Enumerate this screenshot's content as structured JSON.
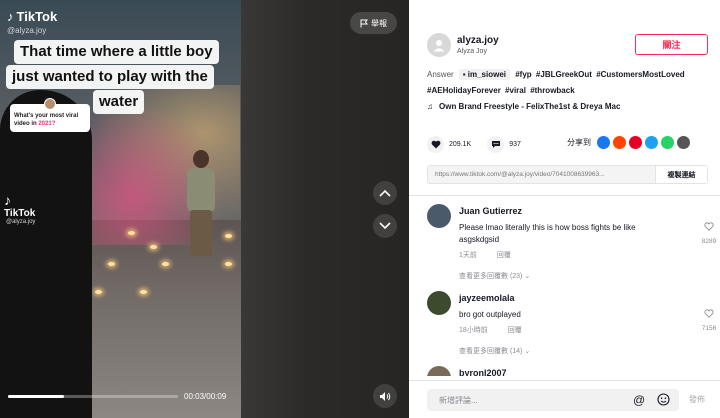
{
  "video": {
    "logo_text": "TikTok",
    "handle": "@alyza.joy",
    "watermark_logo": "TikTok",
    "watermark_handle": "@alyza.joy",
    "caption_lines": [
      "That time where a little boy",
      "just wanted to play with the",
      "water"
    ],
    "viral_card_text": "What's your most viral video in",
    "viral_card_year": "2021?",
    "report_label": "舉報",
    "time_readout": "00:03/00:09",
    "progress_fraction": 0.33,
    "icons": {
      "report": "flag-icon",
      "up": "chevron-up-icon",
      "down": "chevron-down-icon",
      "volume": "volume-icon"
    }
  },
  "author": {
    "name": "alyza.joy",
    "display_name": "Alyza Joy",
    "follow_label": "關注"
  },
  "description": {
    "answer_label": "Answer",
    "answer_user": "im_siowei",
    "hashtags": [
      "#fyp",
      "#JBLGreekOut",
      "#CustomersMostLoved",
      "#AEHolidayForever",
      "#viral",
      "#throwback"
    ]
  },
  "music": {
    "title": "Own Brand Freestyle - FelixThe1st & Dreya Mac"
  },
  "stats": {
    "likes": "209.1K",
    "comments": "937"
  },
  "share": {
    "label": "分享到",
    "targets": [
      {
        "name": "facebook-icon",
        "color": "#1877f2"
      },
      {
        "name": "reddit-icon",
        "color": "#ff4500"
      },
      {
        "name": "pinterest-icon",
        "color": "#e60023"
      },
      {
        "name": "twitter-icon",
        "color": "#1da1f2"
      },
      {
        "name": "whatsapp-icon",
        "color": "#25d366"
      },
      {
        "name": "embed-icon",
        "color": "#555555"
      }
    ]
  },
  "link": {
    "url": "https://www.tiktok.com/@alyza.joy/video/7041008639963...",
    "copy_label": "複製連結"
  },
  "comments": [
    {
      "name": "Juan Gutierrez",
      "text": "Please lmao literally this is how boss fights be like asgskdgsid",
      "time": "1天前",
      "reply_label": "回覆",
      "likes": "8289",
      "more_replies": "查看更多回覆數 (23)",
      "avatar_color": "#4b5a6a"
    },
    {
      "name": "jayzeemolala",
      "text": "bro got outplayed",
      "time": "18小時前",
      "reply_label": "回覆",
      "likes": "7156",
      "more_replies": "查看更多回覆數 (14)",
      "avatar_color": "#3c4a2e"
    },
    {
      "name": "byronl2007",
      "avatar_color": "#7a6a5a"
    }
  ],
  "comment_bar": {
    "placeholder": "新增評論...",
    "post_label": "發佈"
  }
}
